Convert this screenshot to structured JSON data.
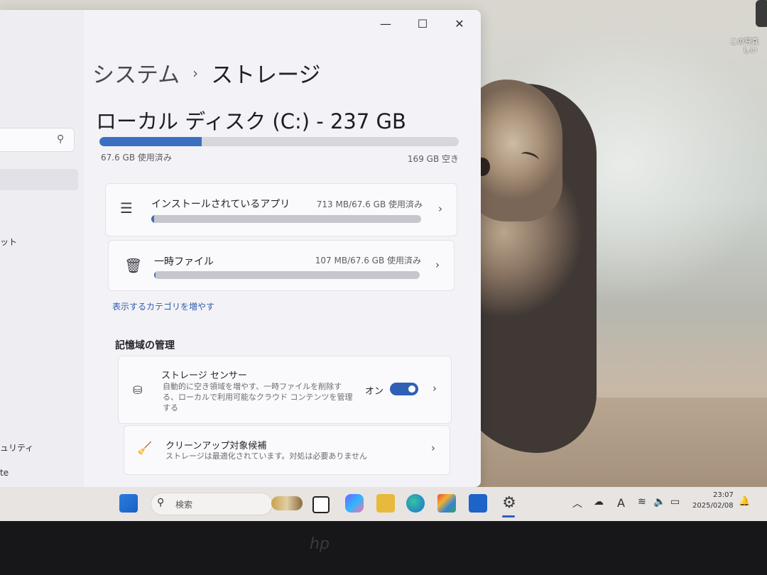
{
  "desktop": {
    "icon_label_line1": "この写真",
    "icon_label_line2": "しい"
  },
  "window": {
    "controls": {
      "minimize": "—",
      "maximize": "☐",
      "close": "✕"
    }
  },
  "sidebar": {
    "frag_1": "ット",
    "frag_2": "ュリティ",
    "frag_3": "te"
  },
  "breadcrumb": {
    "parent": "システム",
    "separator": "›",
    "current": "ストレージ"
  },
  "disk": {
    "title": "ローカル ディスク (C:) - 237 GB",
    "used_label": "67.6 GB 使用済み",
    "free_label": "169 GB 空き",
    "used_fraction": 0.285
  },
  "categories": [
    {
      "name": "インストールされているアプリ",
      "size": "713 MB/67.6 GB 使用済み",
      "fraction": 0.011,
      "icon": "list-icon"
    },
    {
      "name": "一時ファイル",
      "size": "107 MB/67.6 GB 使用済み",
      "fraction": 0.002,
      "icon": "trash-icon"
    }
  ],
  "more_categories_link": "表示するカテゴリを増やす",
  "management": {
    "heading": "記憶域の管理",
    "storage_sense": {
      "title": "ストレージ センサー",
      "description": "自動的に空き領域を増やす、一時ファイルを削除する、ローカルで利用可能なクラウド コンテンツを管理する",
      "toggle_label": "オン",
      "toggle_on": true
    },
    "cleanup": {
      "title": "クリーンアップ対象候補",
      "description": "ストレージは最適化されています。対処は必要ありません"
    }
  },
  "taskbar": {
    "search_label": "検索",
    "time": "23:07",
    "date": "2025/02/08",
    "ime_indicator": "A"
  },
  "colors": {
    "accent": "#3b6fc0",
    "toggle": "#2f60b5"
  }
}
